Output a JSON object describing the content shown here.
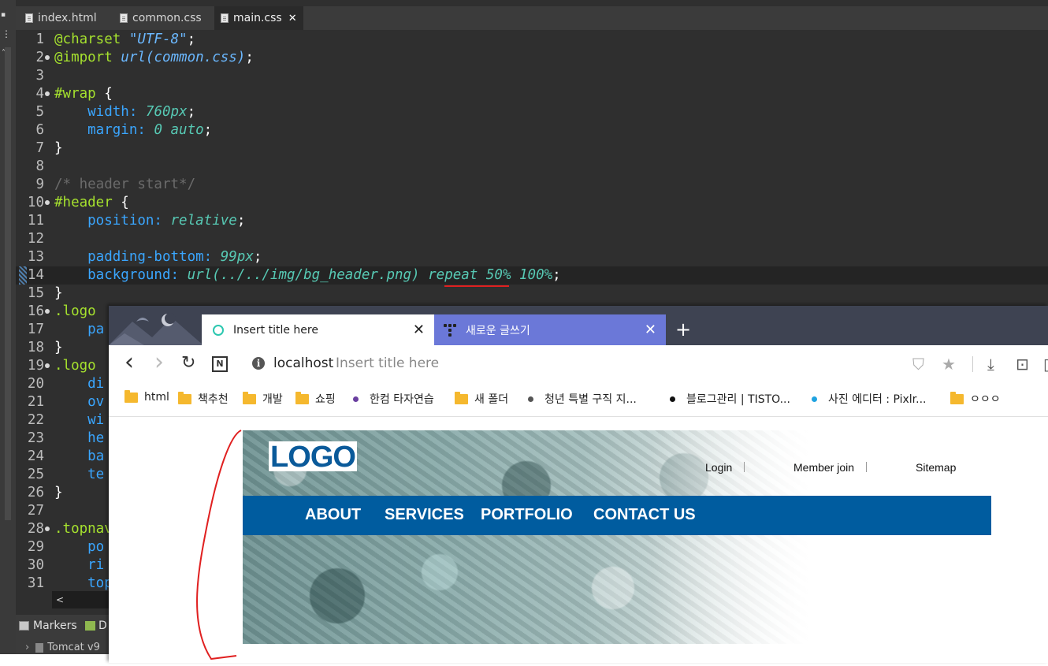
{
  "editor": {
    "tabs": [
      {
        "label": "index.html"
      },
      {
        "label": "common.css"
      },
      {
        "label": "main.css"
      }
    ],
    "tab_close_glyph": "✕",
    "lines": [
      {
        "n": "1"
      },
      {
        "n": "2"
      },
      {
        "n": "3"
      },
      {
        "n": "4"
      },
      {
        "n": "5"
      },
      {
        "n": "6"
      },
      {
        "n": "7"
      },
      {
        "n": "8"
      },
      {
        "n": "9"
      },
      {
        "n": "10"
      },
      {
        "n": "11"
      },
      {
        "n": "12"
      },
      {
        "n": "13"
      },
      {
        "n": "14"
      },
      {
        "n": "15"
      },
      {
        "n": "16"
      },
      {
        "n": "17"
      },
      {
        "n": "18"
      },
      {
        "n": "19"
      },
      {
        "n": "20"
      },
      {
        "n": "21"
      },
      {
        "n": "22"
      },
      {
        "n": "23"
      },
      {
        "n": "24"
      },
      {
        "n": "25"
      },
      {
        "n": "26"
      },
      {
        "n": "27"
      },
      {
        "n": "28"
      },
      {
        "n": "29"
      },
      {
        "n": "30"
      },
      {
        "n": "31"
      }
    ],
    "code": {
      "l1_kw": "@charset ",
      "l1_str": "\"UTF-8\"",
      "l1_end": ";",
      "l2_kw": "@import ",
      "l2_val": "url(common.css)",
      "l2_end": ";",
      "l4_sel": "#wrap ",
      "l4_brace": "{",
      "l5_prop": "    width: ",
      "l5_val": "760px",
      "l5_end": ";",
      "l6_prop": "    margin: ",
      "l6_val": "0 auto",
      "l6_end": ";",
      "l7": "}",
      "l9": "/* header start*/",
      "l10_sel": "#header ",
      "l10_brace": "{",
      "l11_prop": "    position: ",
      "l11_val": "relative",
      "l11_end": ";",
      "l13_prop": "    padding-bottom: ",
      "l13_val": "99px",
      "l13_end": ";",
      "l14_prop": "    background: ",
      "l14_val": "url(../../img/bg_header.png) repeat 50% 100%",
      "l14_end": ";",
      "l15": "}",
      "l16_sel": ".logo ",
      "l17": "    pa",
      "l18": "}",
      "l19_sel": ".logo ",
      "l20": "    di",
      "l21": "    ov",
      "l22": "    wi",
      "l23": "    he",
      "l24": "    ba",
      "l25": "    te",
      "l26": "}",
      "l28_sel": ".topnav",
      "l29": "    po",
      "l30": "    ri",
      "l31": "    top"
    },
    "hscroll_arrow": "<",
    "bottom_panel": {
      "markers_label": "Markers",
      "d_label": "D",
      "tomcat_label": "Tomcat v9"
    }
  },
  "browser": {
    "tabs": [
      {
        "label": "Insert title here",
        "active": true
      },
      {
        "label": "새로운 글쓰기",
        "active": false
      }
    ],
    "close_glyph": "✕",
    "new_tab_glyph": "+",
    "nav": {
      "back": "‹",
      "forward": "›",
      "reload": "↻"
    },
    "url": {
      "host": "localhost",
      "title": "Insert title here"
    },
    "bookmarks": [
      {
        "label": "html",
        "icon": "folder"
      },
      {
        "label": "책추천",
        "icon": "folder"
      },
      {
        "label": "개발",
        "icon": "folder"
      },
      {
        "label": "쇼핑",
        "icon": "folder"
      },
      {
        "label": "한컴 타자연습",
        "icon": "dot",
        "color": "#6a3fa0"
      },
      {
        "label": "새 폴더",
        "icon": "folder"
      },
      {
        "label": "청년 특별 구직 지...",
        "icon": "dot",
        "color": "#555555"
      },
      {
        "label": "블로그관리 | TISTO...",
        "icon": "dot",
        "color": "#111111"
      },
      {
        "label": "사진 에디터 : Pixlr...",
        "icon": "dot",
        "color": "#1fa3e0"
      },
      {
        "label": "ㅇㅇㅇ",
        "icon": "folder"
      }
    ],
    "page": {
      "logo_text": "LOGO",
      "top_links": [
        "Login",
        "Member join",
        "Sitemap"
      ],
      "gnb": [
        "ABOUT",
        "SERVICES",
        "PORTFOLIO",
        "CONTACT US"
      ],
      "gnb_color": "#005c9f"
    }
  },
  "colors": {
    "editor_bg": "#2f2f2f",
    "annotation_red": "#e02020",
    "tab_accent": "#6b78d8"
  }
}
